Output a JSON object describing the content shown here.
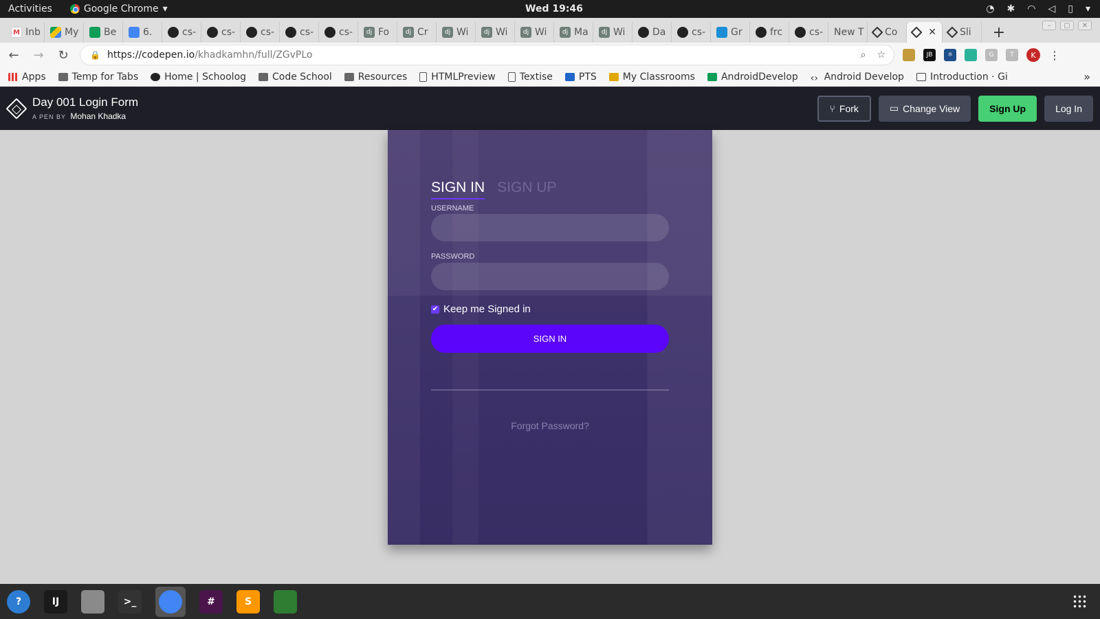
{
  "system": {
    "activities": "Activities",
    "app_name": "Google Chrome",
    "clock": "Wed 19:46"
  },
  "tabs": [
    {
      "label": "Inb",
      "icon": "gmail-icon"
    },
    {
      "label": "My",
      "icon": "drive-icon"
    },
    {
      "label": "Be",
      "icon": "sheets-icon"
    },
    {
      "label": "6.",
      "icon": "docs-icon"
    },
    {
      "label": "cs-",
      "icon": "github-icon"
    },
    {
      "label": "cs-",
      "icon": "github-icon"
    },
    {
      "label": "cs-",
      "icon": "github-icon"
    },
    {
      "label": "cs-",
      "icon": "github-icon"
    },
    {
      "label": "cs-",
      "icon": "github-icon"
    },
    {
      "label": "Fo",
      "icon": "django-icon"
    },
    {
      "label": "Cr",
      "icon": "django-icon"
    },
    {
      "label": "Wi",
      "icon": "django-icon"
    },
    {
      "label": "Wi",
      "icon": "django-icon"
    },
    {
      "label": "Wi",
      "icon": "django-icon"
    },
    {
      "label": "Ma",
      "icon": "django-icon"
    },
    {
      "label": "Wi",
      "icon": "django-icon"
    },
    {
      "label": "Da",
      "icon": "github-icon"
    },
    {
      "label": "cs-",
      "icon": "github-icon"
    },
    {
      "label": "Gr",
      "icon": "grammarly-icon"
    },
    {
      "label": "frc",
      "icon": "github-icon"
    },
    {
      "label": "cs-",
      "icon": "github-icon"
    },
    {
      "label": "New T",
      "icon": ""
    },
    {
      "label": "Co",
      "icon": "codepen-icon"
    },
    {
      "label": "",
      "icon": "codepen-icon",
      "active": true
    },
    {
      "label": "Sli",
      "icon": "codepen-icon"
    }
  ],
  "address": {
    "host": "https://codepen.io",
    "path": "/khadkamhn/full/ZGvPLo"
  },
  "profile_initial": "K",
  "bookmarks": [
    {
      "label": "Apps",
      "icon": "apps"
    },
    {
      "label": "Temp for Tabs",
      "icon": "folder"
    },
    {
      "label": "Home | Schoolog",
      "icon": "schoology"
    },
    {
      "label": "Code School",
      "icon": "folder"
    },
    {
      "label": "Resources",
      "icon": "folder"
    },
    {
      "label": "HTMLPreview",
      "icon": "page"
    },
    {
      "label": "Textise",
      "icon": "page"
    },
    {
      "label": "PTS",
      "icon": "mdb"
    },
    {
      "label": "My Classrooms",
      "icon": "box"
    },
    {
      "label": "AndroidDevelop",
      "icon": "drive"
    },
    {
      "label": "Android Develop",
      "icon": "code"
    },
    {
      "label": "Introduction · Gi",
      "icon": "book"
    }
  ],
  "codepen": {
    "title": "Day 001 Login Form",
    "by_label": "A PEN BY",
    "author": "Mohan Khadka",
    "fork": "Fork",
    "change_view": "Change View",
    "sign_up": "Sign Up",
    "log_in": "Log In"
  },
  "login": {
    "tab_signin": "SIGN IN",
    "tab_signup": "SIGN UP",
    "username_label": "USERNAME",
    "username_value": "",
    "password_label": "PASSWORD",
    "password_value": "",
    "keep_signed": "Keep me Signed in",
    "keep_signed_checked": true,
    "button": "SIGN IN",
    "forgot": "Forgot Password?"
  },
  "dock": [
    {
      "name": "help-icon",
      "glyph": "?"
    },
    {
      "name": "intellij-icon",
      "glyph": "IJ"
    },
    {
      "name": "files-icon",
      "glyph": ""
    },
    {
      "name": "terminal-icon",
      "glyph": ">_"
    },
    {
      "name": "chrome-icon",
      "glyph": "",
      "active": true
    },
    {
      "name": "slack-icon",
      "glyph": "#"
    },
    {
      "name": "sublime-icon",
      "glyph": "S"
    },
    {
      "name": "monitor-icon",
      "glyph": ""
    }
  ],
  "colors": {
    "accent": "#5b06fb",
    "codepen_header": "#1e1f26",
    "signup_green": "#47cf73"
  }
}
